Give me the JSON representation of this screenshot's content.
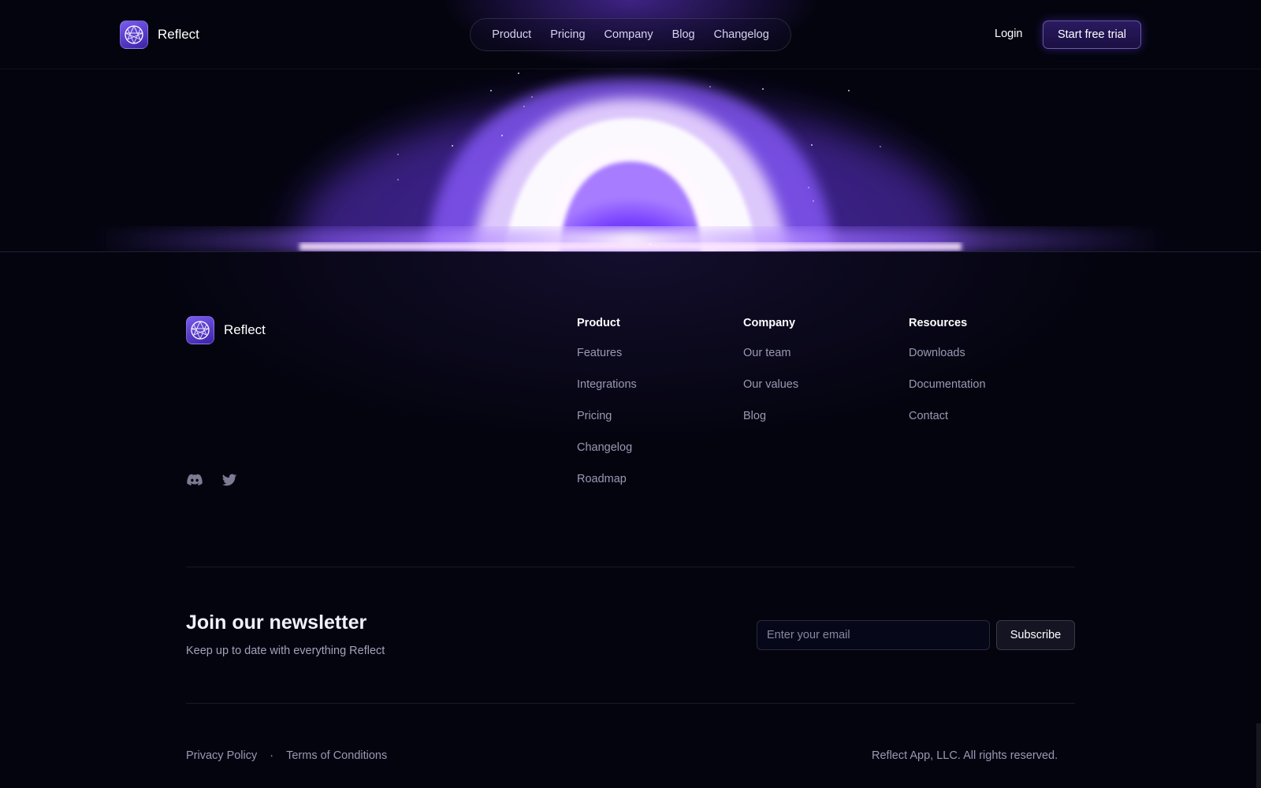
{
  "header": {
    "brand": "Reflect",
    "nav": [
      "Product",
      "Pricing",
      "Company",
      "Blog",
      "Changelog"
    ],
    "login": "Login",
    "cta": "Start free trial"
  },
  "footer": {
    "brand": "Reflect",
    "socials": [
      "discord-icon",
      "twitter-icon"
    ],
    "columns": [
      {
        "title": "Product",
        "links": [
          "Features",
          "Integrations",
          "Pricing",
          "Changelog",
          "Roadmap"
        ]
      },
      {
        "title": "Company",
        "links": [
          "Our team",
          "Our values",
          "Blog"
        ]
      },
      {
        "title": "Resources",
        "links": [
          "Downloads",
          "Documentation",
          "Contact"
        ]
      }
    ],
    "newsletter": {
      "title": "Join our newsletter",
      "subtitle": "Keep up to date with everything Reflect",
      "placeholder": "Enter your email",
      "button": "Subscribe"
    },
    "legal": {
      "privacy": "Privacy Policy",
      "separator": "·",
      "terms": "Terms of Conditions",
      "copyright": "Reflect App, LLC. All rights reserved."
    }
  },
  "colors": {
    "background": "#04040f",
    "accent": "#7a4cff",
    "glow": "#f3e6ff"
  }
}
